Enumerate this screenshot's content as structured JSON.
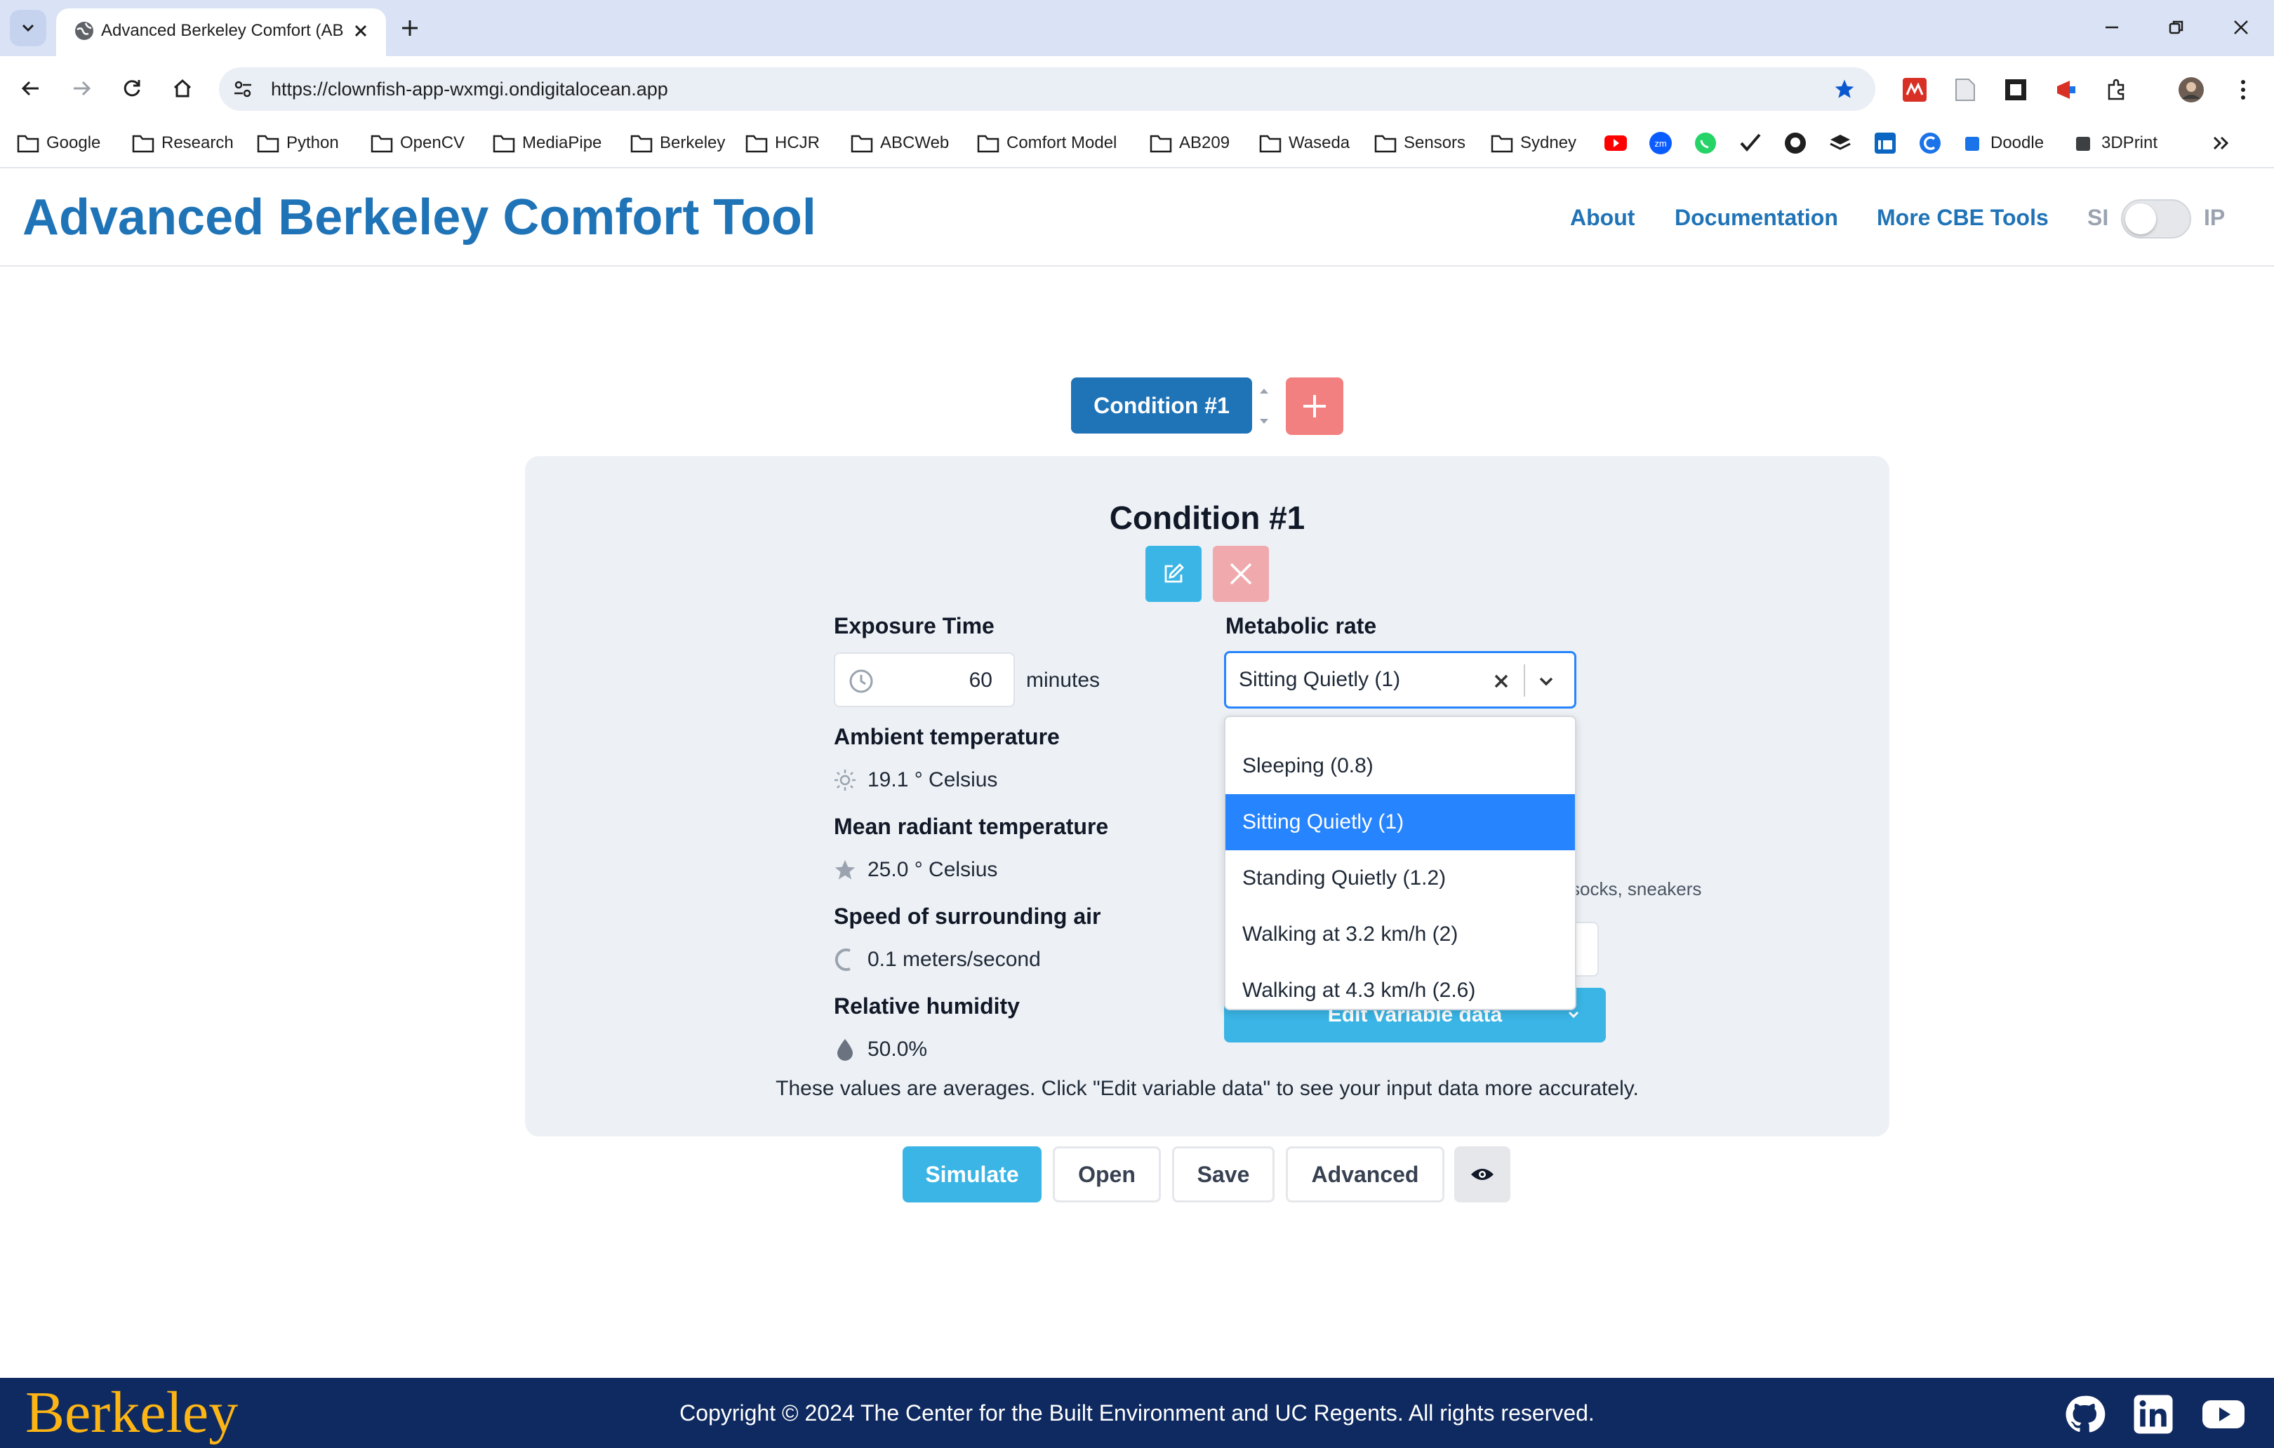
{
  "browser": {
    "tab_title": "Advanced Berkeley Comfort (AB",
    "url": "https://clownfish-app-wxmgi.ondigitalocean.app",
    "bookmarks": [
      "Google",
      "Research",
      "Python",
      "OpenCV",
      "MediaPipe",
      "Berkeley",
      "HCJR",
      "ABCWeb",
      "Comfort Model",
      "AB209",
      "Waseda",
      "Sensors",
      "Sydney"
    ],
    "bookmark_tail": [
      "Doodle",
      "3DPrint"
    ],
    "accent_color": "#0b57d0"
  },
  "header": {
    "title": "Advanced Berkeley Comfort Tool",
    "nav": [
      "About",
      "Documentation",
      "More CBE Tools"
    ],
    "unit_left": "SI",
    "unit_right": "IP",
    "brand_color": "#1f73b7"
  },
  "conditions": {
    "active_tab": "Condition #1"
  },
  "panel": {
    "title": "Condition #1",
    "exposure": {
      "label": "Exposure Time",
      "value": "60",
      "unit": "minutes"
    },
    "ambient": {
      "label": "Ambient temperature",
      "value": "19.1 ° Celsius"
    },
    "radiant": {
      "label": "Mean radiant temperature",
      "value": "25.0 ° Celsius"
    },
    "air_speed": {
      "label": "Speed of surrounding air",
      "value": "0.1 meters/second"
    },
    "humidity": {
      "label": "Relative humidity",
      "value": "50.0%"
    },
    "metabolic": {
      "label": "Metabolic rate",
      "selected": "Sitting Quietly (1)",
      "options": [
        "Sleeping (0.8)",
        "Sitting Quietly (1)",
        "Standing Quietly (1.2)",
        "Walking at 3.2 km/h (2)",
        "Walking at 4.3 km/h (2.6)"
      ]
    },
    "clothing_desc": "socks, sneakers",
    "edit_variable_label": "Edit variable data",
    "note": "These values are averages. Click \"Edit variable data\" to see your input data more accurately."
  },
  "actions": {
    "simulate": "Simulate",
    "open": "Open",
    "save": "Save",
    "advanced": "Advanced"
  },
  "footer": {
    "logo_text": "Berkeley",
    "copyright": "Copyright © 2024 The Center for the Built Environment and UC Regents. All rights reserved.",
    "logo_color": "#fdb515",
    "bg_color": "#0f2a60"
  }
}
